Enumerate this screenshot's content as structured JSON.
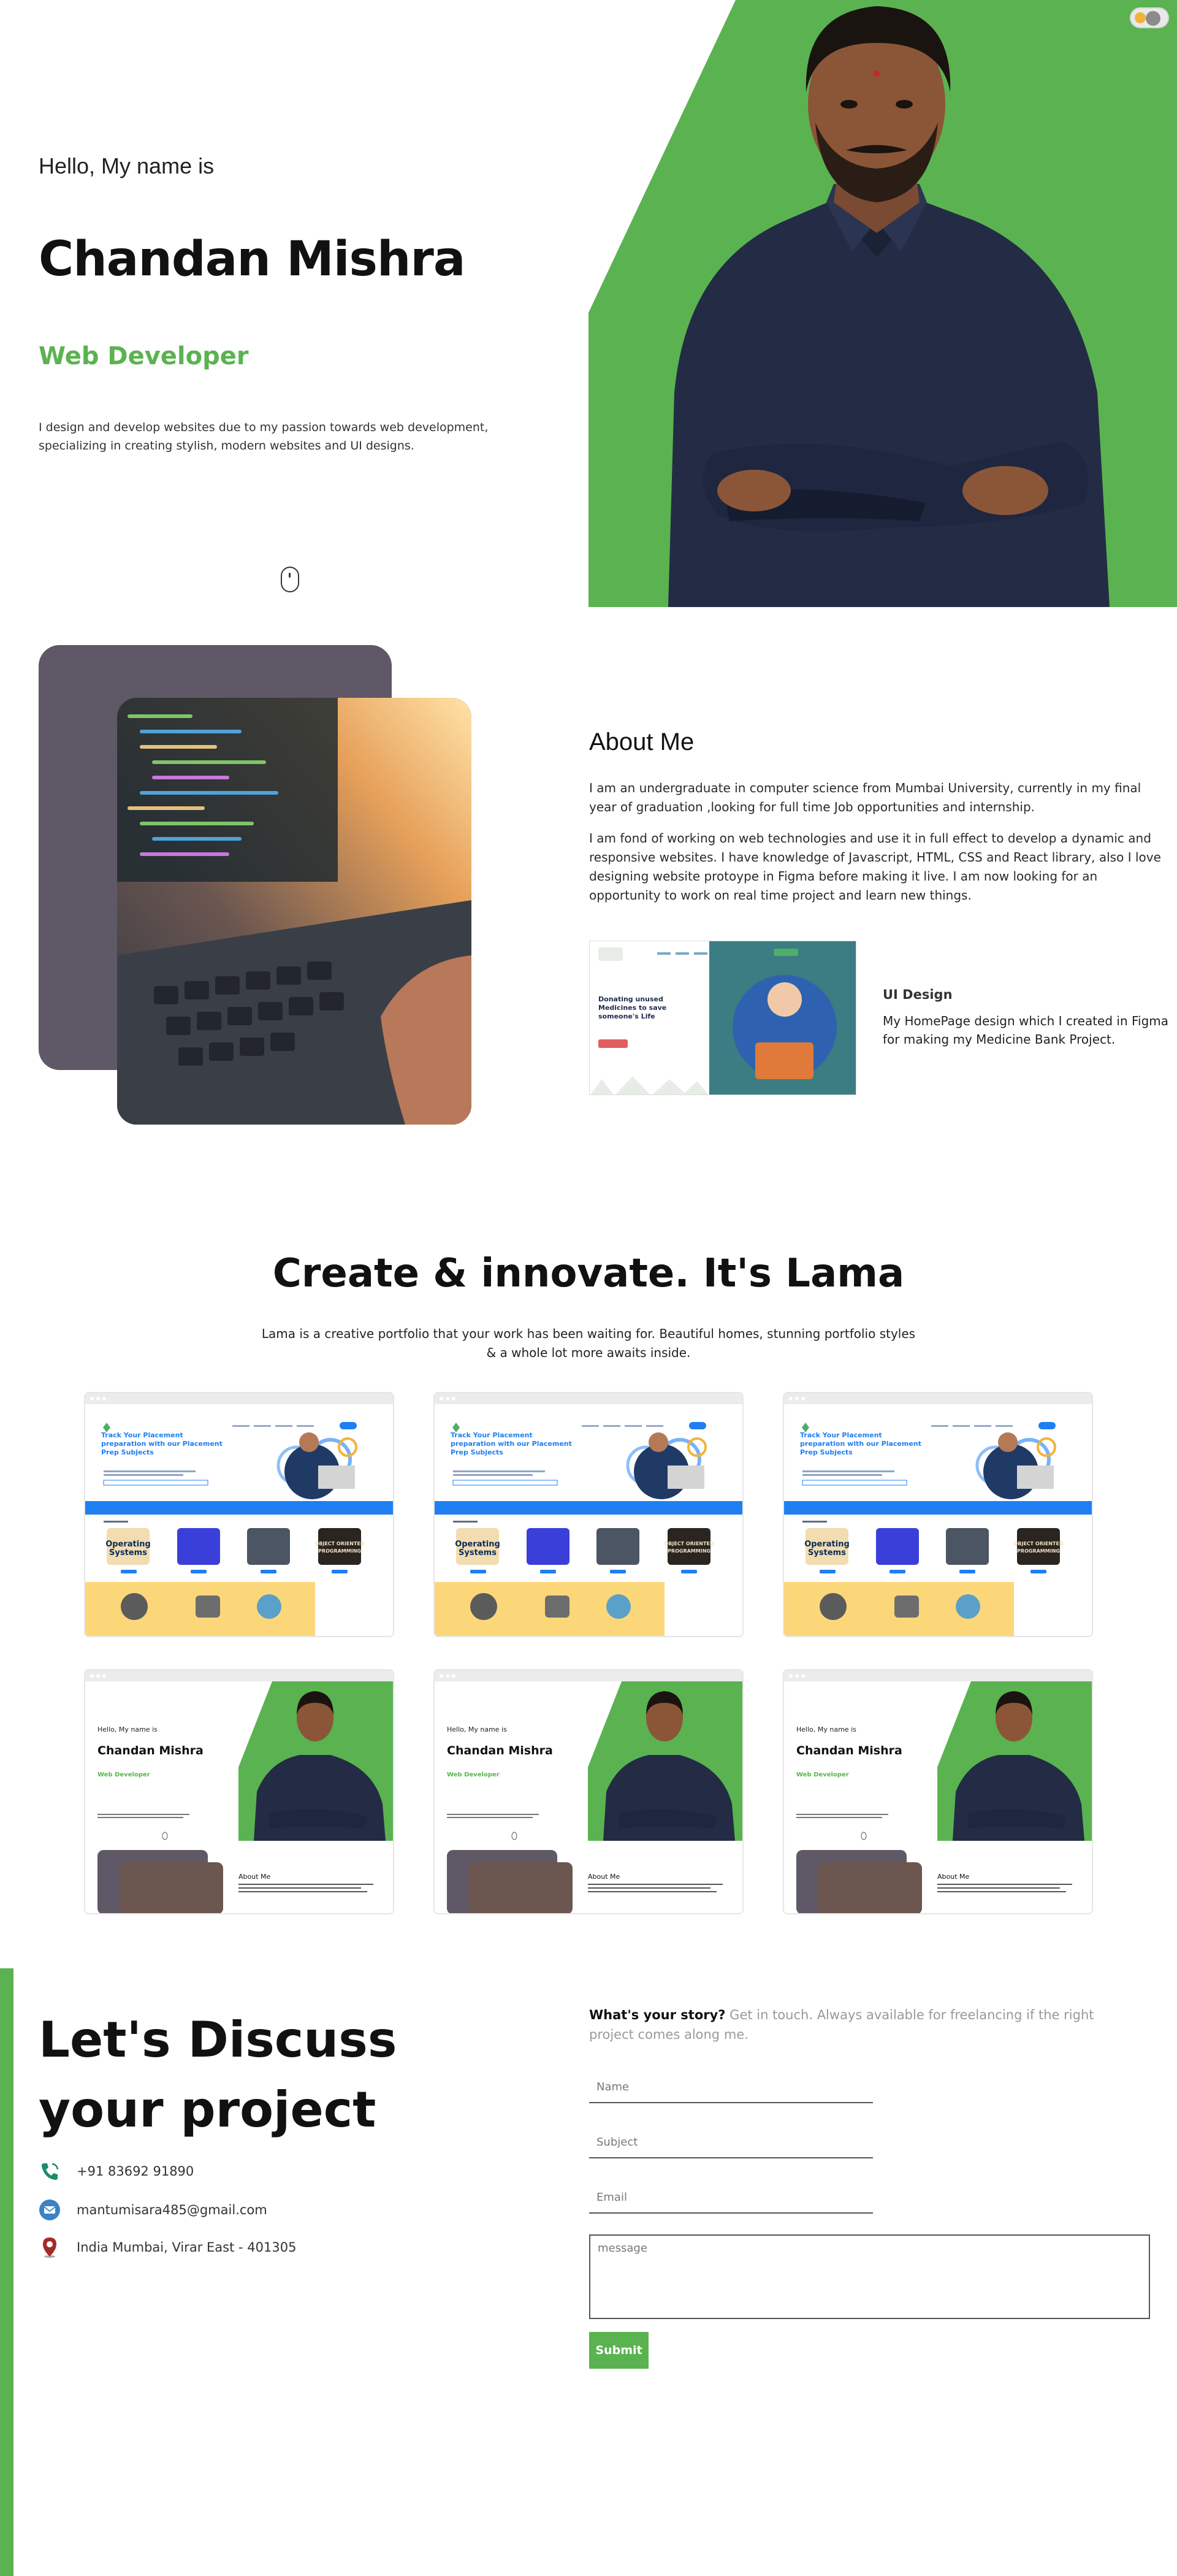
{
  "hero": {
    "greeting": "Hello, My name is",
    "name": "Chandan Mishra",
    "role": "Web Developer",
    "intro": "I design and develop websites due to my passion towards web development, specializing in creating stylish, modern websites and UI designs."
  },
  "about": {
    "title": "About Me",
    "paragraph1": "I am an undergraduate in computer science from Mumbai University, currently in my final year of graduation ,looking for full time Job opportunities and internship.",
    "paragraph2": "I am fond of working on web technologies and use it in full effect to develop a dynamic and responsive websites. I have knowledge of Javascript, HTML, CSS and React library, also I love designing website protoype in Figma before making it live. I am now looking for an opportunity to work on real time project and learn new things.",
    "project": {
      "title": "UI Design",
      "description": "My HomePage design which I created in Figma for making my Medicine Bank Project.",
      "thumb_headline": "Donating unused Medicines to save someone's Life"
    }
  },
  "portfolio": {
    "title": "Create & innovate. It's Lama",
    "description": "Lama is a creative portfolio that your work has been waiting for. Beautiful homes, stunning portfolio styles & a whole lot more awaits inside.",
    "placement_cards": [
      {
        "headline": "Track Your Placement preparation with our Placement Prep Subjects"
      },
      {
        "headline": "Track Your Placement preparation with our Placement Prep Subjects"
      },
      {
        "headline": "Track Your Placement preparation with our Placement Prep Subjects"
      }
    ],
    "portfolio_cards": [
      {
        "greeting": "Hello, My name is",
        "name": "Chandan Mishra",
        "role": "Web Developer",
        "about": "About Me"
      },
      {
        "greeting": "Hello, My name is",
        "name": "Chandan Mishra",
        "role": "Web Developer",
        "about": "About Me"
      },
      {
        "greeting": "Hello, My name is",
        "name": "Chandan Mishra",
        "role": "Web Developer",
        "about": "About Me"
      }
    ]
  },
  "contact": {
    "title": "Let's Discuss your project",
    "phone": "+91 83692 91890",
    "email": "mantumisara485@gmail.com",
    "address": "India Mumbai, Virar East - 401305",
    "story_bold": "What's your story?",
    "story_text": " Get in touch. Always available for freelancing if the right project comes along me.",
    "form": {
      "name_placeholder": "Name",
      "subject_placeholder": "Subject",
      "email_placeholder": "Email",
      "message_placeholder": "message",
      "submit_label": "Submit"
    }
  },
  "colors": {
    "accent": "#5ab350",
    "dark_card": "#5f5866",
    "text": "#111111"
  },
  "icons": {
    "theme_toggle": "sun-moon-toggle-icon",
    "scroll": "mouse-scroll-icon",
    "phone": "phone-icon",
    "email": "email-icon",
    "address": "location-pin-icon"
  }
}
